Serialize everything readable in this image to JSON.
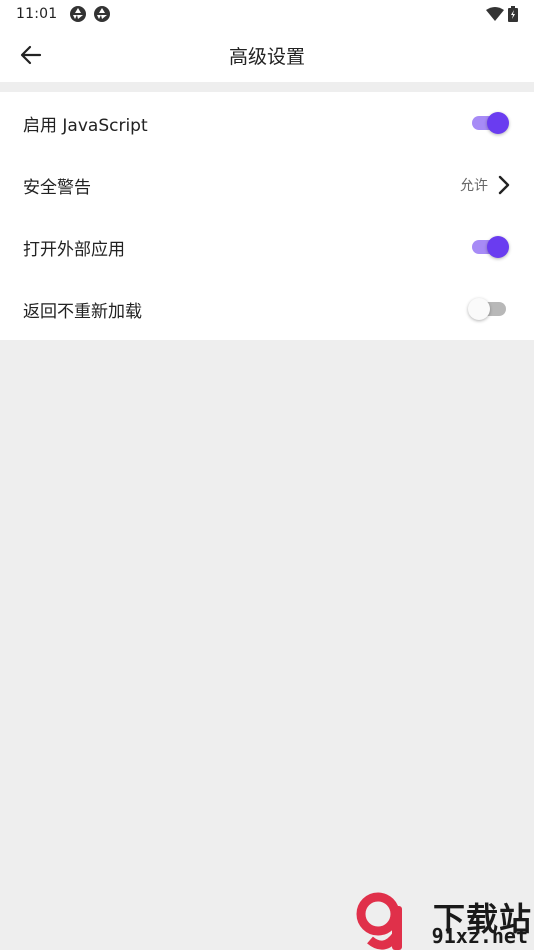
{
  "status_bar": {
    "time": "11:01"
  },
  "app_bar": {
    "title": "高级设置"
  },
  "settings": [
    {
      "label": "启用 JavaScript",
      "type": "toggle",
      "on": true
    },
    {
      "label": "安全警告",
      "type": "value",
      "value": "允许"
    },
    {
      "label": "打开外部应用",
      "type": "toggle",
      "on": true
    },
    {
      "label": "返回不重新加载",
      "type": "toggle",
      "on": false
    }
  ],
  "watermark": {
    "brand": "下载站",
    "url": "91xz.net"
  },
  "colors": {
    "accent": "#6a3cf0",
    "accent_track": "#a78bf6",
    "background": "#eeeeee",
    "surface": "#ffffff"
  }
}
